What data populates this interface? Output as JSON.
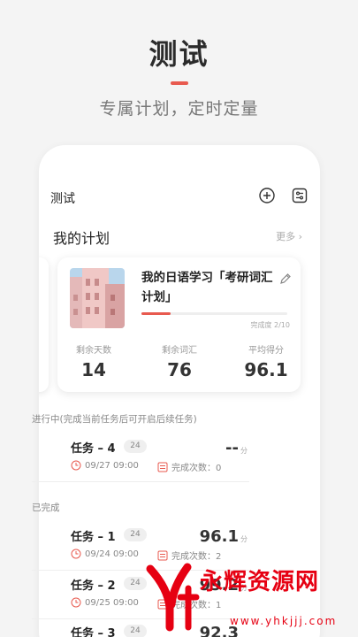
{
  "hero": {
    "title": "测试",
    "subtitle": "专属计划，定时定量"
  },
  "colors": {
    "accent": "#e85a4f",
    "watermark": "#e60012"
  },
  "topbar": {
    "title": "测试",
    "add_icon": "plus-circle-icon",
    "settings_icon": "sliders-icon"
  },
  "plans": {
    "header": "我的计划",
    "more_label": "更多",
    "card": {
      "title": "我的日语学习「考研词汇计划」",
      "progress_label": "完成度 2/10",
      "progress_fraction": 0.2,
      "stats": [
        {
          "label": "剩余天数",
          "value": "14"
        },
        {
          "label": "剩余词汇",
          "value": "76"
        },
        {
          "label": "平均得分",
          "value": "96.1"
        }
      ]
    }
  },
  "in_progress": {
    "label": "进行中(完成当前任务后可开启后续任务)",
    "tasks": [
      {
        "name": "任务 – 4",
        "badge": "24",
        "score": "--",
        "unit": "分",
        "date": "09/27 09:00",
        "count": "完成次数：0"
      }
    ]
  },
  "completed": {
    "label": "已完成",
    "tasks": [
      {
        "name": "任务 – 1",
        "badge": "24",
        "score": "96.1",
        "unit": "分",
        "date": "09/24 09:00",
        "count": "完成次数：2"
      },
      {
        "name": "任务 – 2",
        "badge": "24",
        "score": "99.2",
        "unit": "分",
        "date": "09/25 09:00",
        "count": "完成次数：1"
      },
      {
        "name": "任务 – 3",
        "badge": "24",
        "score": "92.3",
        "unit": "分",
        "date": "",
        "count": ""
      }
    ]
  },
  "watermark": {
    "text": "永辉资源网",
    "url": "www.yhkjjj.com"
  }
}
